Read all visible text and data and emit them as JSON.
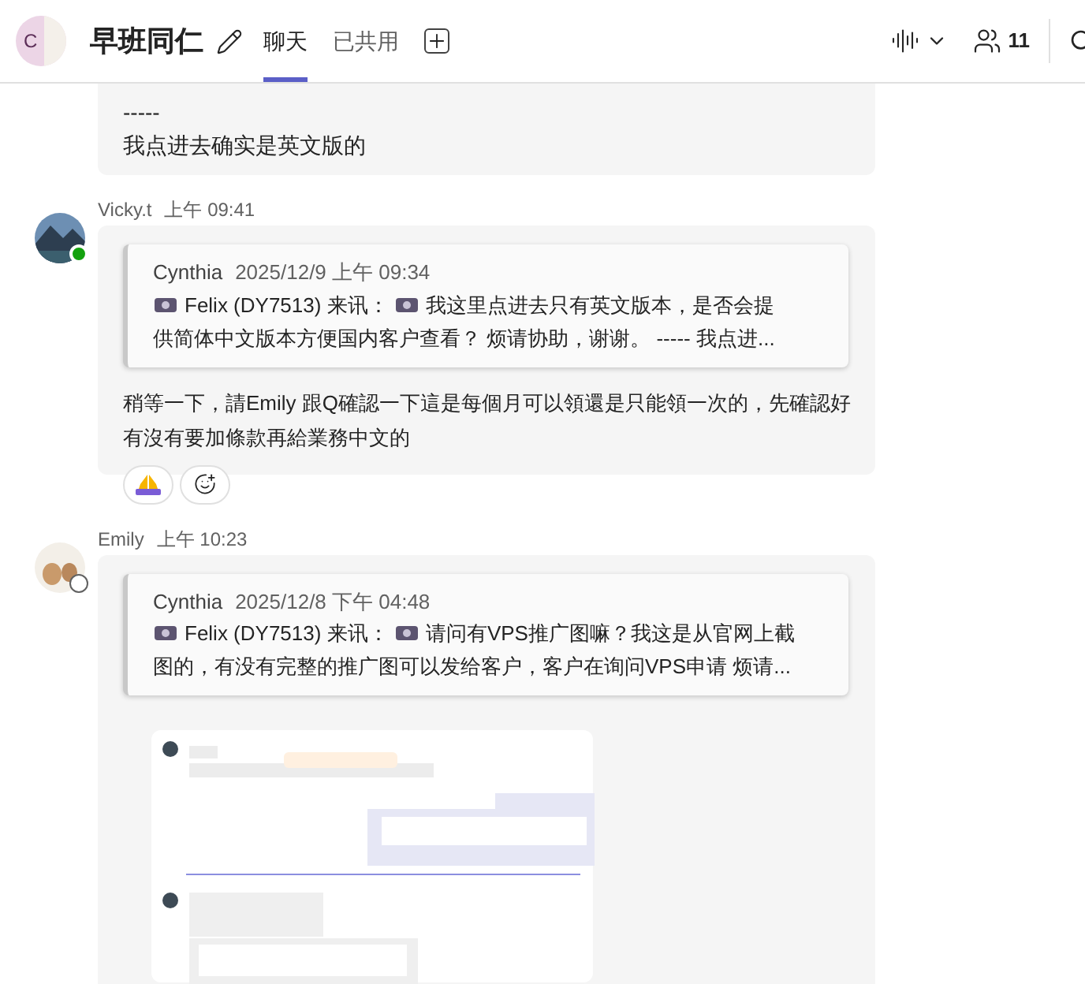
{
  "header": {
    "avatar_letter": "C",
    "title": "早班同仁",
    "tabs": [
      {
        "label": "聊天",
        "selected": true
      },
      {
        "label": "已共用",
        "selected": false
      }
    ],
    "participant_count": "11"
  },
  "messages": [
    {
      "kind": "continued",
      "lines": [
        "-----",
        "我点进去确实是英文版的"
      ]
    },
    {
      "kind": "message",
      "author": "Vicky.t",
      "time": "上午 09:41",
      "online": true,
      "quote": {
        "author": "Cynthia",
        "time": "2025/12/9 上午 09:34",
        "lines": [
          "Felix (DY7513) 来讯：",
          "我这里点进去只有英文版本，是否会提",
          "供简体中文版本方便国内客户查看？ 烦请协助，谢谢。 ----- 我点进..."
        ]
      },
      "text": "稍等一下，請Emily 跟Q確認一下這是每個月可以領還是只能領一次的，先確認好有沒有要加條款再給業務中文的",
      "reactions": true
    },
    {
      "kind": "message",
      "author": "Emily",
      "time": "上午 10:23",
      "online": false,
      "quote": {
        "author": "Cynthia",
        "time": "2025/12/8 下午 04:48",
        "lines": [
          "Felix (DY7513) 来讯：",
          "请问有VPS推广图嘛？我这是从官网上截",
          "图的，有没有完整的推广图可以发给客户，客户在询问VPS申请 烦请..."
        ]
      },
      "reactions": false
    }
  ]
}
